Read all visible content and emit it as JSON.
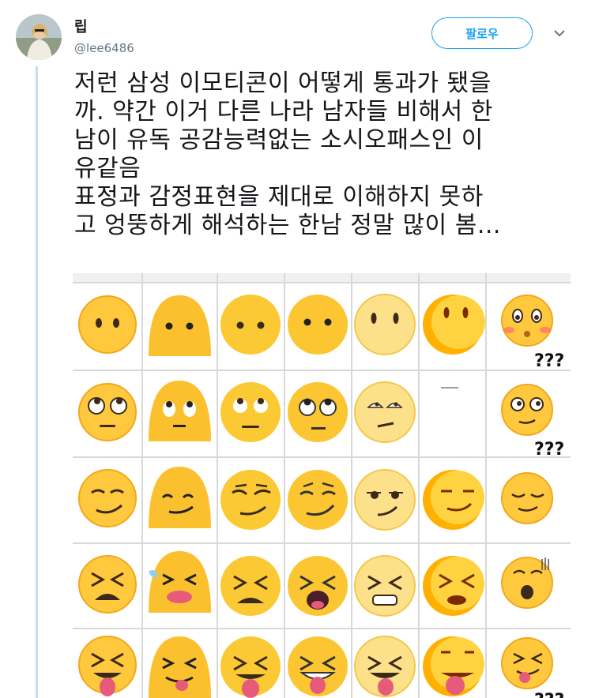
{
  "author": {
    "name": "립",
    "handle": "@lee6486"
  },
  "follow_button": {
    "label": "팔로우"
  },
  "tweet": {
    "lines": [
      "저런 삼성 이모티콘이 어떻게 통과가 됐을",
      "까. 약간 이거 다른 나라 남자들 비해서 한",
      "남이 유독 공감능력없는 소시오패스인 이",
      "유같음",
      "표정과 감정표현을 제대로 이해하지 못하",
      "고 엉뚱하게 해석하는 한남 정말 많이 봄..."
    ]
  },
  "media": {
    "question_marks": [
      "???",
      "???",
      "???"
    ],
    "rows": [
      "neutral-face",
      "eye-roll-face",
      "smirk-face",
      "tired-face",
      "tongue-out-face"
    ],
    "colors": {
      "emoji_yellow": "#ffc83d",
      "emoji_light": "#fde08a",
      "feature": "#3b2a1a",
      "tongue": "#e75b7a"
    }
  }
}
